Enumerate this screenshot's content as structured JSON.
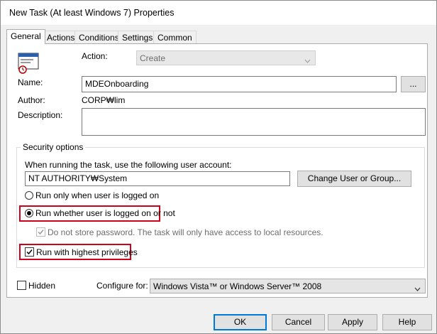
{
  "window": {
    "title": "New Task (At least Windows 7) Properties"
  },
  "tabs": [
    {
      "label": "General",
      "active": true
    },
    {
      "label": "Actions"
    },
    {
      "label": "Conditions"
    },
    {
      "label": "Settings"
    },
    {
      "label": "Common"
    }
  ],
  "general": {
    "action_label": "Action:",
    "action_value": "Create",
    "name_label": "Name:",
    "name_value": "MDEOnboarding",
    "browse_label": "...",
    "author_label": "Author:",
    "author_value": "CORP₩lim",
    "description_label": "Description:",
    "description_value": ""
  },
  "security": {
    "group_title": "Security options",
    "account_prompt": "When running the task, use the following user account:",
    "account_value": "NT AUTHORITY₩System",
    "change_user_label": "Change User or Group...",
    "radio_logged_on": "Run only when user is logged on",
    "radio_whether": "Run whether user is logged on or not",
    "no_store_password": "Do not store password. The task will only have access to local resources.",
    "highest_privileges": "Run with highest privileges",
    "selected_radio": "whether",
    "highest_checked": true
  },
  "bottom": {
    "hidden_label": "Hidden",
    "configure_label": "Configure for:",
    "configure_value": "Windows Vista™ or Windows Server™ 2008"
  },
  "buttons": {
    "ok": "OK",
    "cancel": "Cancel",
    "apply": "Apply",
    "help": "Help"
  },
  "colors": {
    "highlight_box": "#d0021b",
    "default_button_border": "#0078d7"
  }
}
